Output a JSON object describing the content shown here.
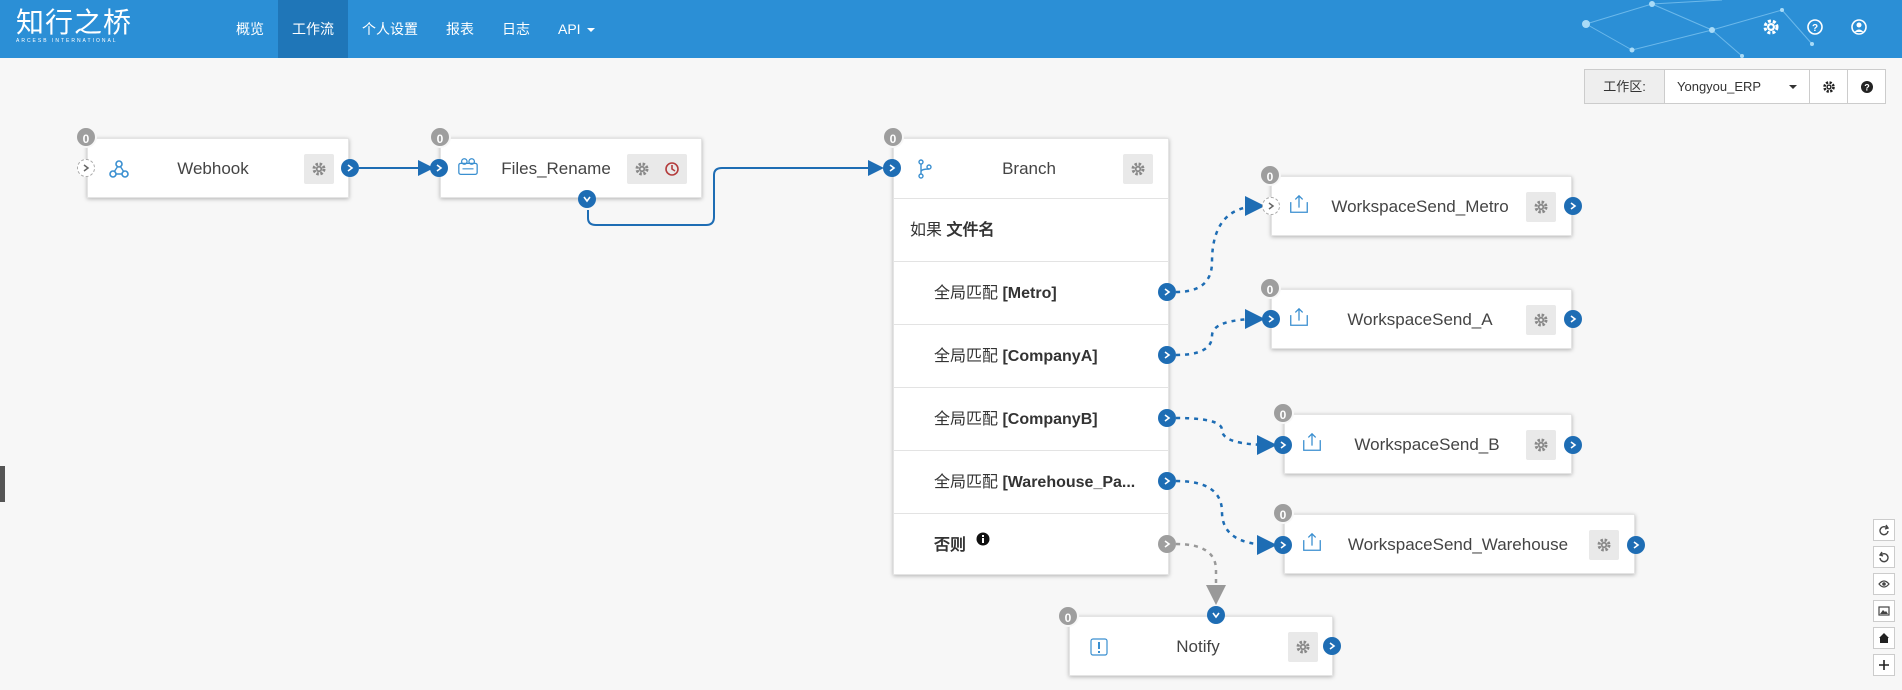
{
  "app": {
    "logo_cn": "知行之桥",
    "logo_en": "ARCESB INTERNATIONAL"
  },
  "nav": {
    "items": [
      "概览",
      "工作流",
      "个人设置",
      "报表",
      "日志"
    ],
    "api": "API",
    "active_index": 1
  },
  "top_icons": [
    "gear-icon",
    "help-icon",
    "user-icon"
  ],
  "workspace": {
    "label": "工作区:",
    "value": "Yongyou_ERP"
  },
  "nodes": {
    "webhook": {
      "title": "Webhook",
      "badge": "0"
    },
    "files_rename": {
      "title": "Files_Rename",
      "badge": "0"
    },
    "branch": {
      "title": "Branch",
      "badge": "0",
      "if_prefix": "如果",
      "if_field": "文件名",
      "match_prefix": "全局匹配",
      "cases": [
        "[Metro]",
        "[CompanyA]",
        "[CompanyB]",
        "[Warehouse_Pa..."
      ],
      "else_label": "否则"
    },
    "ws_metro": {
      "title": "WorkspaceSend_Metro",
      "badge": "0"
    },
    "ws_a": {
      "title": "WorkspaceSend_A",
      "badge": "0"
    },
    "ws_b": {
      "title": "WorkspaceSend_B",
      "badge": "0"
    },
    "ws_warehouse": {
      "title": "WorkspaceSend_Warehouse",
      "badge": "0"
    },
    "notify": {
      "title": "Notify",
      "badge": "0"
    }
  },
  "colors": {
    "topbar": "#2b8fd6",
    "nav_active": "#1f76b8",
    "port": "#1e6db4",
    "badge": "#9e9e9e"
  },
  "canvas_tools": [
    "redo-icon",
    "undo-icon",
    "eye-icon",
    "image-icon",
    "home-icon",
    "zoom-in-icon"
  ]
}
